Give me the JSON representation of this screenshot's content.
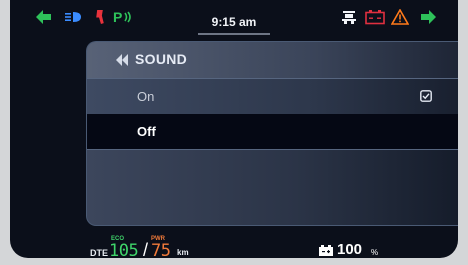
{
  "status_bar": {
    "time": "9:15 am",
    "icons": [
      "left-turn-signal-icon",
      "high-beam-icon",
      "kickstand-icon",
      "parking-indicator-icon",
      "hazard-lights-icon",
      "battery-warning-icon",
      "warning-triangle-icon",
      "right-turn-signal-icon"
    ]
  },
  "menu": {
    "back_icon": "double-chevron-left-icon",
    "title": "SOUND",
    "options": [
      {
        "label": "On",
        "checked": true,
        "highlighted": false
      },
      {
        "label": "Off",
        "checked": false,
        "highlighted": true
      }
    ]
  },
  "range": {
    "label": "DTE",
    "eco_label": "ECO",
    "eco_value": "105",
    "separator": "/",
    "pwr_label": "PWR",
    "pwr_value": "75",
    "unit": "km"
  },
  "battery": {
    "value": "100",
    "unit": "%"
  },
  "colors": {
    "turn_signal": "#2ec25a",
    "eco": "#3fd46a",
    "power": "#f07a3a",
    "warning": "#ff7a1a",
    "battery_warning": "#e03040",
    "high_beam": "#3b8cff"
  }
}
